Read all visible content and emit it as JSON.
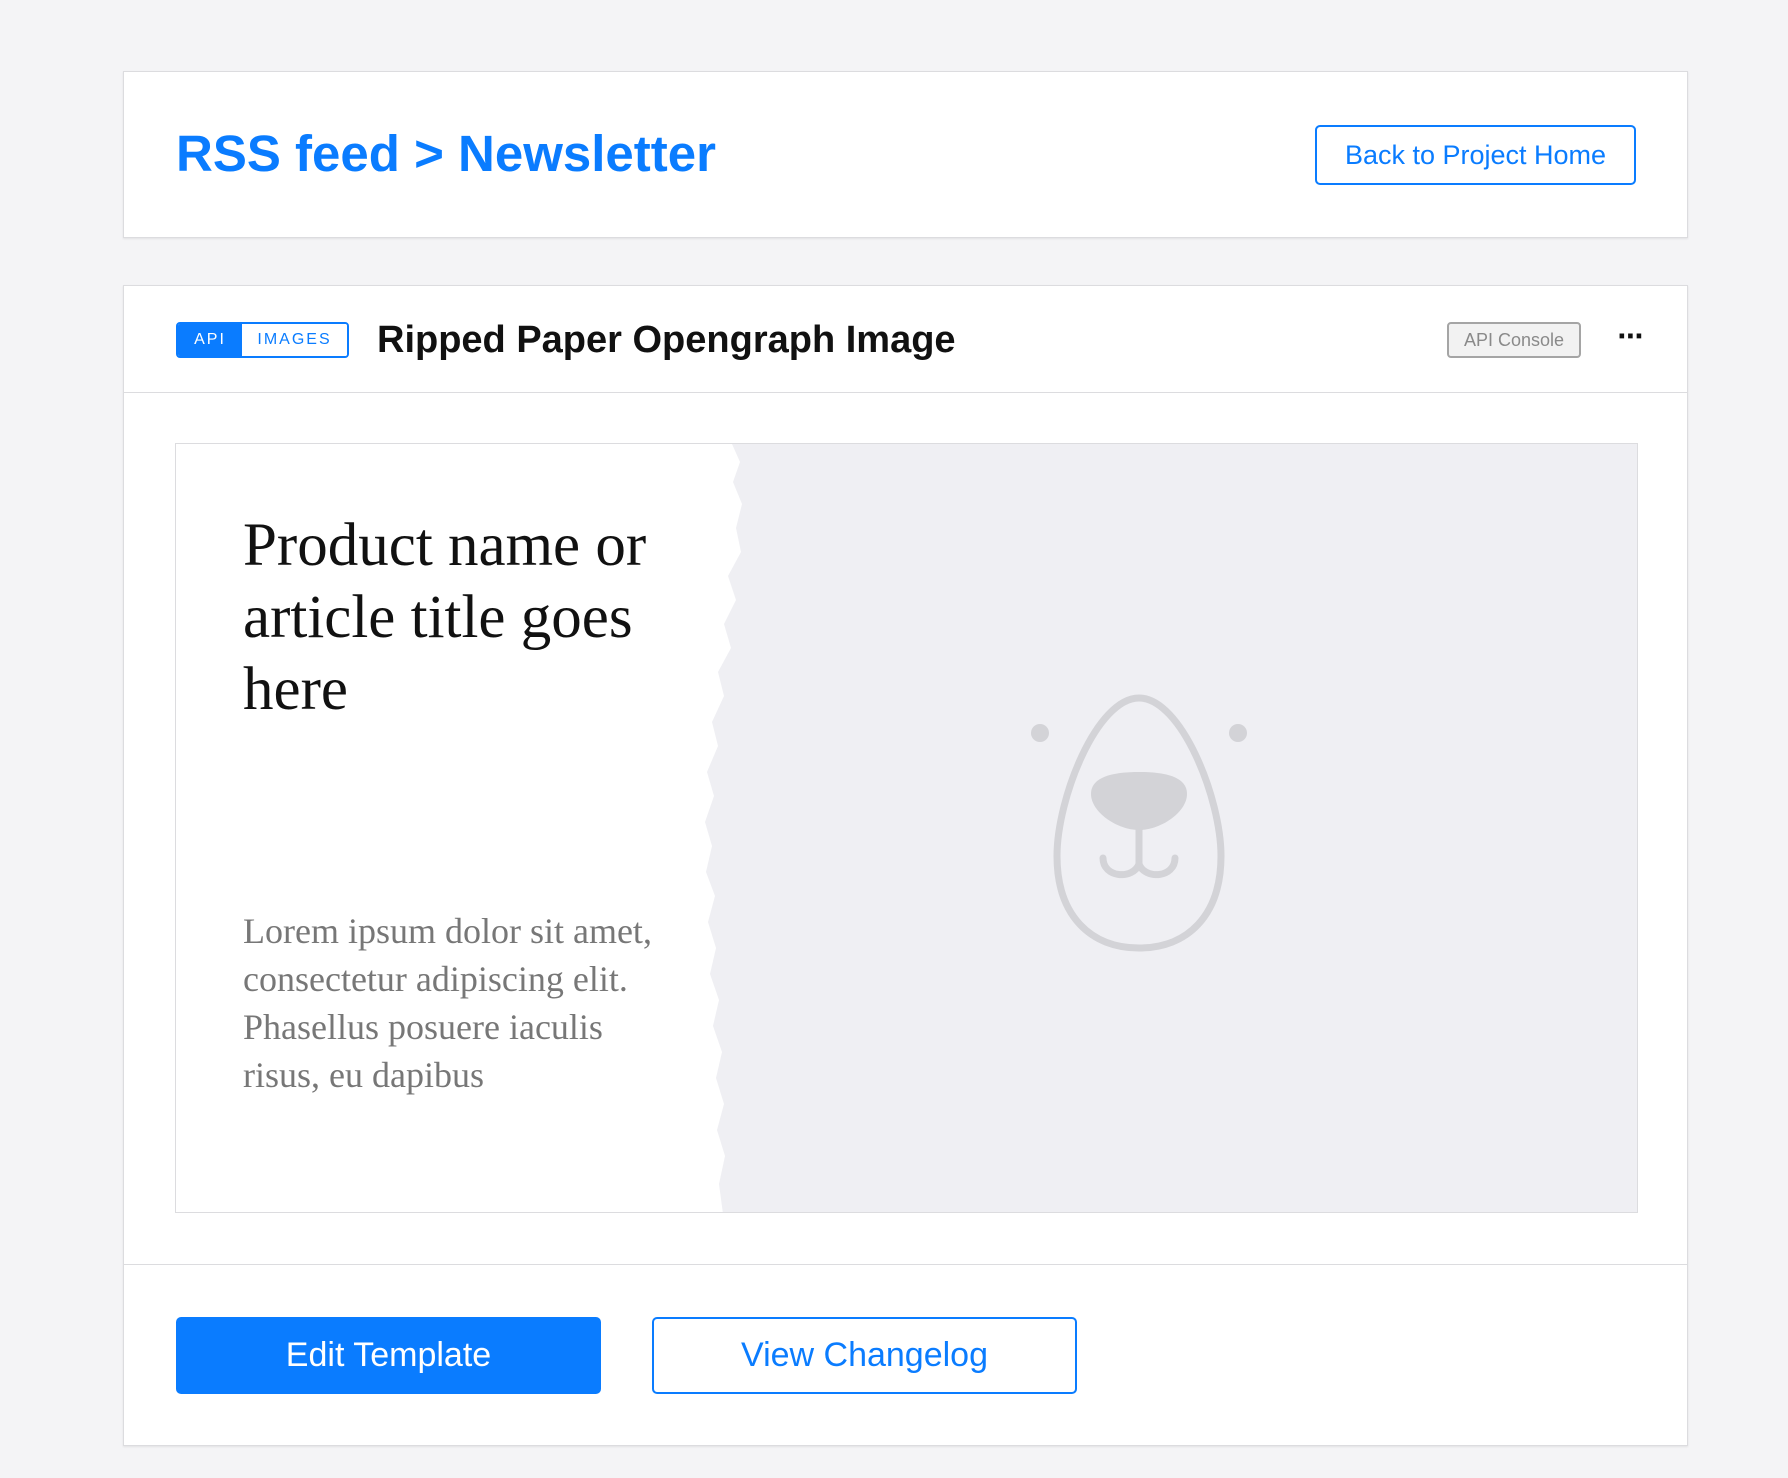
{
  "header": {
    "breadcrumb": "RSS feed > Newsletter",
    "back_button": "Back to Project Home"
  },
  "template": {
    "tags": {
      "api": "API",
      "images": "IMAGES"
    },
    "title": "Ripped Paper Opengraph Image",
    "api_console": "API Console",
    "more_icon": "more-icon",
    "preview": {
      "title": "Product name or article title goes here",
      "body": "Lorem ipsum dolor sit amet, consectetur adipiscing elit. Phasellus posuere iaculis risus, eu dapibus",
      "placeholder_icon": "bear-placeholder-icon"
    },
    "edit_button": "Edit Template",
    "changelog_button": "View Changelog"
  },
  "colors": {
    "accent": "#0a7cff",
    "page_background": "#f4f4f6",
    "preview_background": "#efeff3"
  }
}
